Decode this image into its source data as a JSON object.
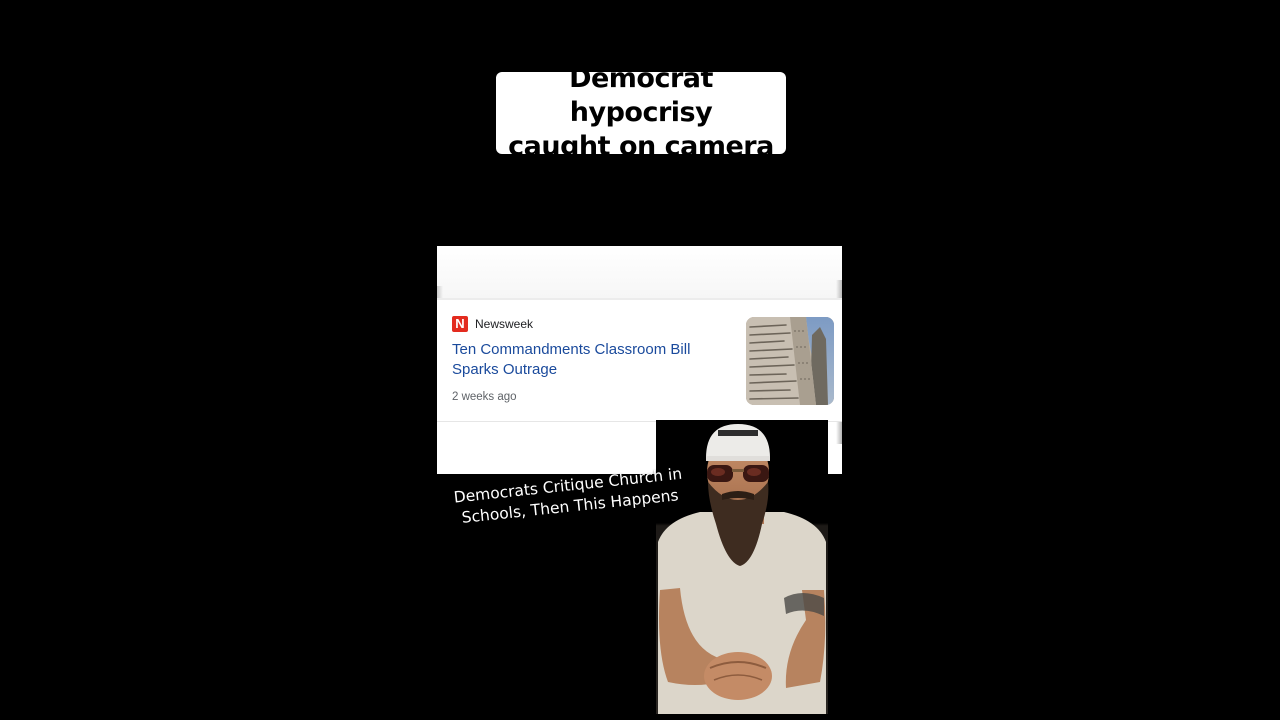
{
  "caption": {
    "text": "Democrat hypocrisy\ncaught on camera"
  },
  "news_card": {
    "source_logo": "N",
    "source_name": "Newsweek",
    "headline": "Ten Commandments Classroom Bill Sparks Outrage",
    "timestamp": "2 weeks ago",
    "thumbnail_icon": "stone-tablet-thumbnail",
    "headline_color": "#1a4a9c",
    "logo_color": "#e32b1f"
  },
  "overlay_caption": {
    "text": "Democrats Critique Church in\nSchools, Then This Happens"
  },
  "presenter": {
    "icon": "person-with-cap-and-sunglasses"
  }
}
